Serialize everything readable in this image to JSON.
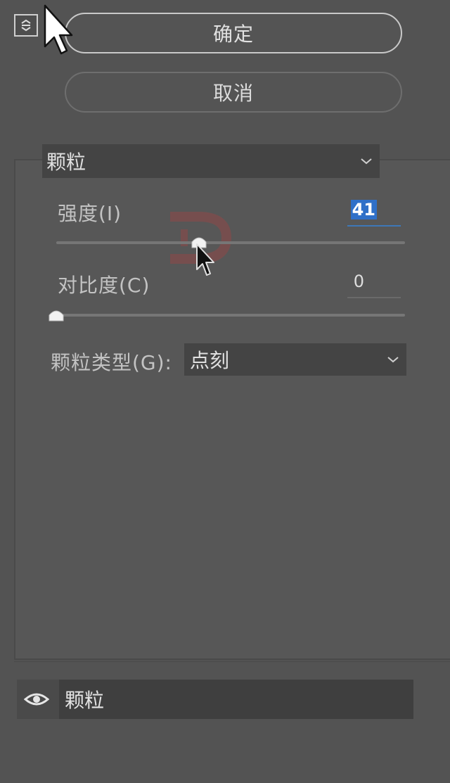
{
  "buttons": {
    "ok_label": "确定",
    "cancel_label": "取消"
  },
  "filter": {
    "selected": "颗粒"
  },
  "controls": {
    "intensity": {
      "label": "强度(I)",
      "value": "41",
      "slider_fraction": 0.41
    },
    "contrast": {
      "label": "对比度(C)",
      "value": "0",
      "slider_fraction": 0.0
    },
    "grain_type": {
      "label": "颗粒类型(G):",
      "selected": "点刻"
    }
  },
  "layers": {
    "items": [
      {
        "name": "颗粒",
        "visible": true
      }
    ]
  },
  "icons": {
    "collapse": "collapse-icon",
    "dropdown": "chevron-down-icon",
    "visibility": "eye-icon"
  },
  "colors": {
    "background": "#535353",
    "selection": "#2f70c8",
    "watermark": "#b04040"
  }
}
